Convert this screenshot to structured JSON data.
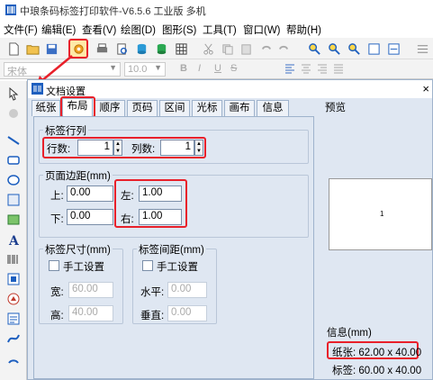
{
  "app": {
    "title": "中琅条码标签打印软件-V6.5.6 工业版 多机"
  },
  "menu": [
    "文件(F)",
    "编辑(E)",
    "查看(V)",
    "绘图(D)",
    "图形(S)",
    "工具(T)",
    "窗口(W)",
    "帮助(H)"
  ],
  "toolbar2": {
    "font_name": "宋体",
    "font_size": "10.0",
    "bold": "B",
    "italic": "I",
    "underline": "U",
    "strike": "S"
  },
  "dialog": {
    "title": "文档设置",
    "close": "×",
    "tabs": [
      "纸张",
      "布局",
      "顺序",
      "页码",
      "区间",
      "光标",
      "画布",
      "信息"
    ],
    "active_tab": "布局",
    "label_rows_group": {
      "title": "标签行列",
      "rows_label": "行数:",
      "rows_value": "1",
      "cols_label": "列数:",
      "cols_value": "1"
    },
    "margins_group": {
      "title": "页面边距(mm)",
      "top_label": "上:",
      "top_value": "0.00",
      "bottom_label": "下:",
      "bottom_value": "0.00",
      "left_label": "左:",
      "left_value": "1.00",
      "right_label": "右:",
      "right_value": "1.00"
    },
    "label_size_group": {
      "title": "标签尺寸(mm)",
      "manual_label": "手工设置",
      "width_label": "宽:",
      "width_value": "60.00",
      "height_label": "高:",
      "height_value": "40.00"
    },
    "label_gap_group": {
      "title": "标签间距(mm)",
      "manual_label": "手工设置",
      "horizontal_label": "水平:",
      "horizontal_value": "0.00",
      "vertical_label": "垂直:",
      "vertical_value": "0.00"
    },
    "preview": {
      "title": "预览",
      "page_number": "1"
    },
    "info": {
      "title": "信息(mm)",
      "paper": "纸张: 62.00 x 40.00",
      "label": "标签: 60.00 x 40.00"
    }
  },
  "colors": {
    "highlight": "#e8202a",
    "dialog_bg": "#dfe7f2"
  }
}
